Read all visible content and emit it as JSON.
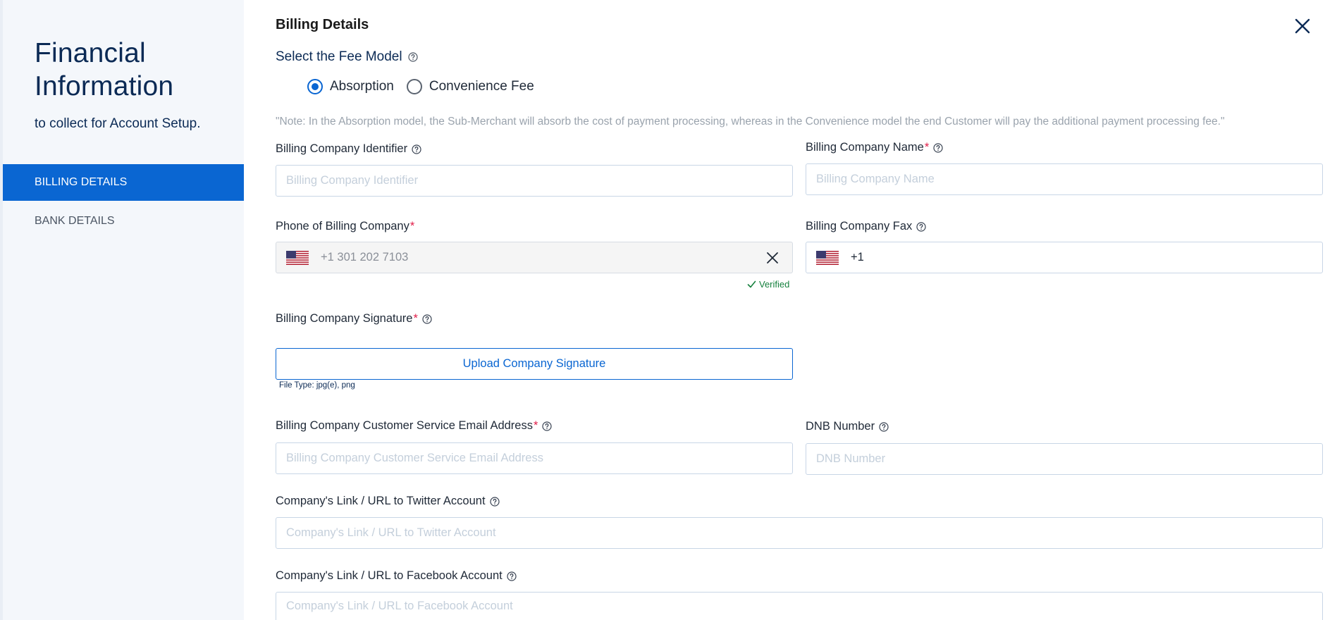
{
  "sidebar": {
    "title_line1": "Financial",
    "title_line2": "Information",
    "subtitle": "to collect for Account Setup.",
    "items": [
      {
        "label": "BILLING DETAILS",
        "active": true
      },
      {
        "label": "BANK DETAILS",
        "active": false
      }
    ]
  },
  "header": {
    "title": "Billing Details",
    "close_icon": "close-icon"
  },
  "fee_model": {
    "label": "Select the Fee Model",
    "options": [
      {
        "label": "Absorption",
        "selected": true
      },
      {
        "label": "Convenience Fee",
        "selected": false
      }
    ],
    "note": "\"Note: In the Absorption model, the Sub-Merchant will absorb the cost of payment processing, whereas in the Convenience model the end Customer will pay the additional payment processing fee.\""
  },
  "fields": {
    "identifier": {
      "label": "Billing Company Identifier",
      "placeholder": "Billing Company Identifier"
    },
    "name": {
      "label": "Billing Company Name",
      "required_mark": "*",
      "placeholder": "Billing Company Name"
    },
    "phone": {
      "label": "Phone of Billing Company",
      "required_mark": "*",
      "value": "+1 301 202 7103",
      "status": "Verified"
    },
    "fax": {
      "label": "Billing Company Fax",
      "value": "+1"
    },
    "signature": {
      "label": "Billing Company Signature",
      "required_mark": "*",
      "button_label": "Upload Company Signature",
      "file_types": "File Type: jpg(e), png"
    },
    "email": {
      "label": "Billing Company Customer Service Email Address",
      "required_mark": "*",
      "placeholder": "Billing Company Customer Service Email Address"
    },
    "dnb": {
      "label": "DNB Number",
      "placeholder": "DNB Number"
    },
    "twitter": {
      "label": "Company's Link / URL to Twitter Account",
      "placeholder": "Company's Link / URL to Twitter Account"
    },
    "facebook": {
      "label": "Company's Link / URL to Facebook Account",
      "placeholder": "Company's Link / URL to Facebook Account"
    }
  },
  "colors": {
    "accent": "#0a66d2",
    "sidebar_bg": "#f4f7fb",
    "title_navy": "#0b2a55",
    "required": "#e11d48",
    "verified": "#15803d"
  }
}
